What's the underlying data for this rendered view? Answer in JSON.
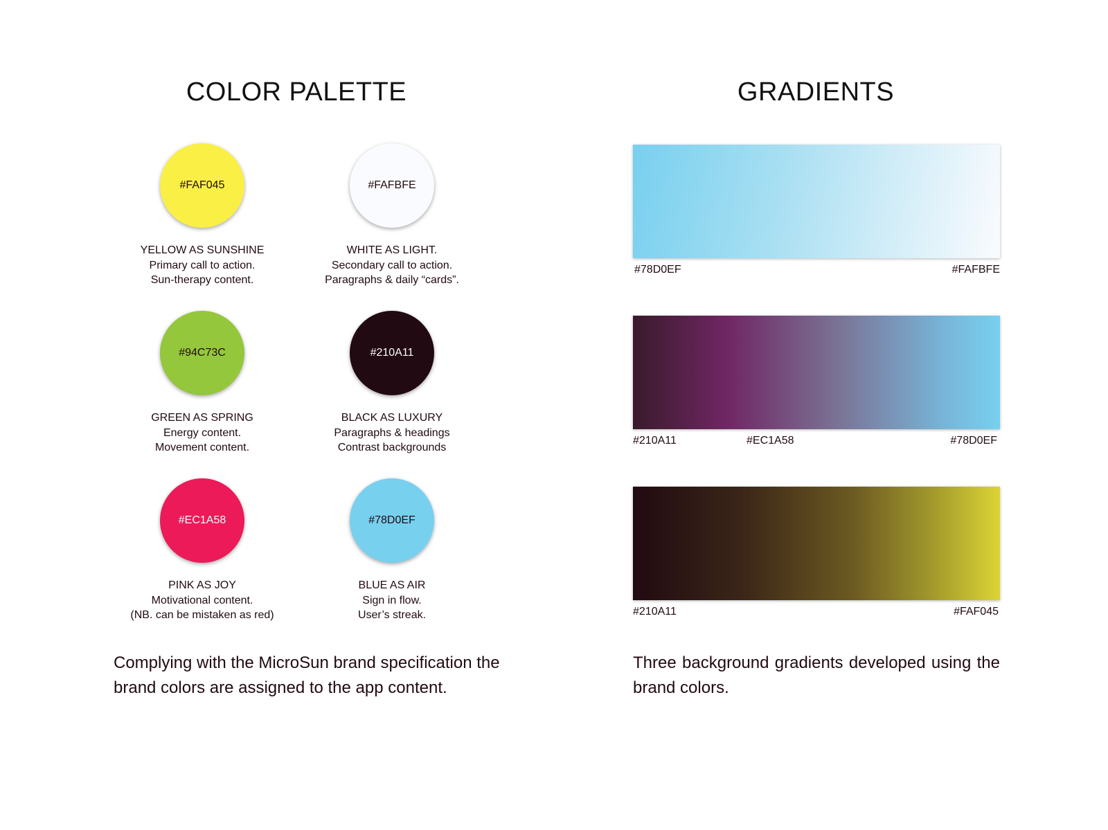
{
  "palette": {
    "title": "COLOR PALETTE",
    "swatches": [
      {
        "hex": "#FAF045",
        "text_color": "#210A11",
        "lines": [
          "YELLOW AS SUNSHINE",
          "Primary call to action.",
          "Sun-therapy content."
        ]
      },
      {
        "hex": "#FAFBFE",
        "text_color": "#210A11",
        "lines": [
          "WHITE AS LIGHT.",
          "Secondary call to action.",
          "Paragraphs & daily “cards”."
        ]
      },
      {
        "hex": "#94C73C",
        "text_color": "#210A11",
        "lines": [
          "GREEN AS SPRING",
          "Energy content.",
          "Movement content."
        ]
      },
      {
        "hex": "#210A11",
        "text_color": "#FAFBFE",
        "lines": [
          "BLACK AS LUXURY",
          "Paragraphs & headings",
          "Contrast backgrounds"
        ]
      },
      {
        "hex": "#EC1A58",
        "text_color": "#FAFBFE",
        "lines": [
          "PINK AS JOY",
          "Motivational content.",
          "(NB. can be mistaken as red)"
        ]
      },
      {
        "hex": "#78D0EF",
        "text_color": "#210A11",
        "lines": [
          "BLUE AS AIR",
          "Sign in flow.",
          "User’s streak."
        ]
      }
    ],
    "note": "Complying with the MicroSun brand specification the brand colors are assigned to the app content."
  },
  "gradients": {
    "title": "GRADIENTS",
    "items": [
      {
        "stops": [
          "#78D0EF",
          "#FAFBFE"
        ],
        "labels": [
          "#78D0EF",
          "#FAFBFE"
        ]
      },
      {
        "stops": [
          "#210A11",
          "#EC1A58",
          "#78D0EF"
        ],
        "labels": [
          "#210A11",
          "#EC1A58",
          "#78D0EF"
        ]
      },
      {
        "stops": [
          "#210A11",
          "#FAF045"
        ],
        "labels": [
          "#210A11",
          "#FAF045"
        ]
      }
    ],
    "note": "Three background gradients developed using the brand colors."
  }
}
